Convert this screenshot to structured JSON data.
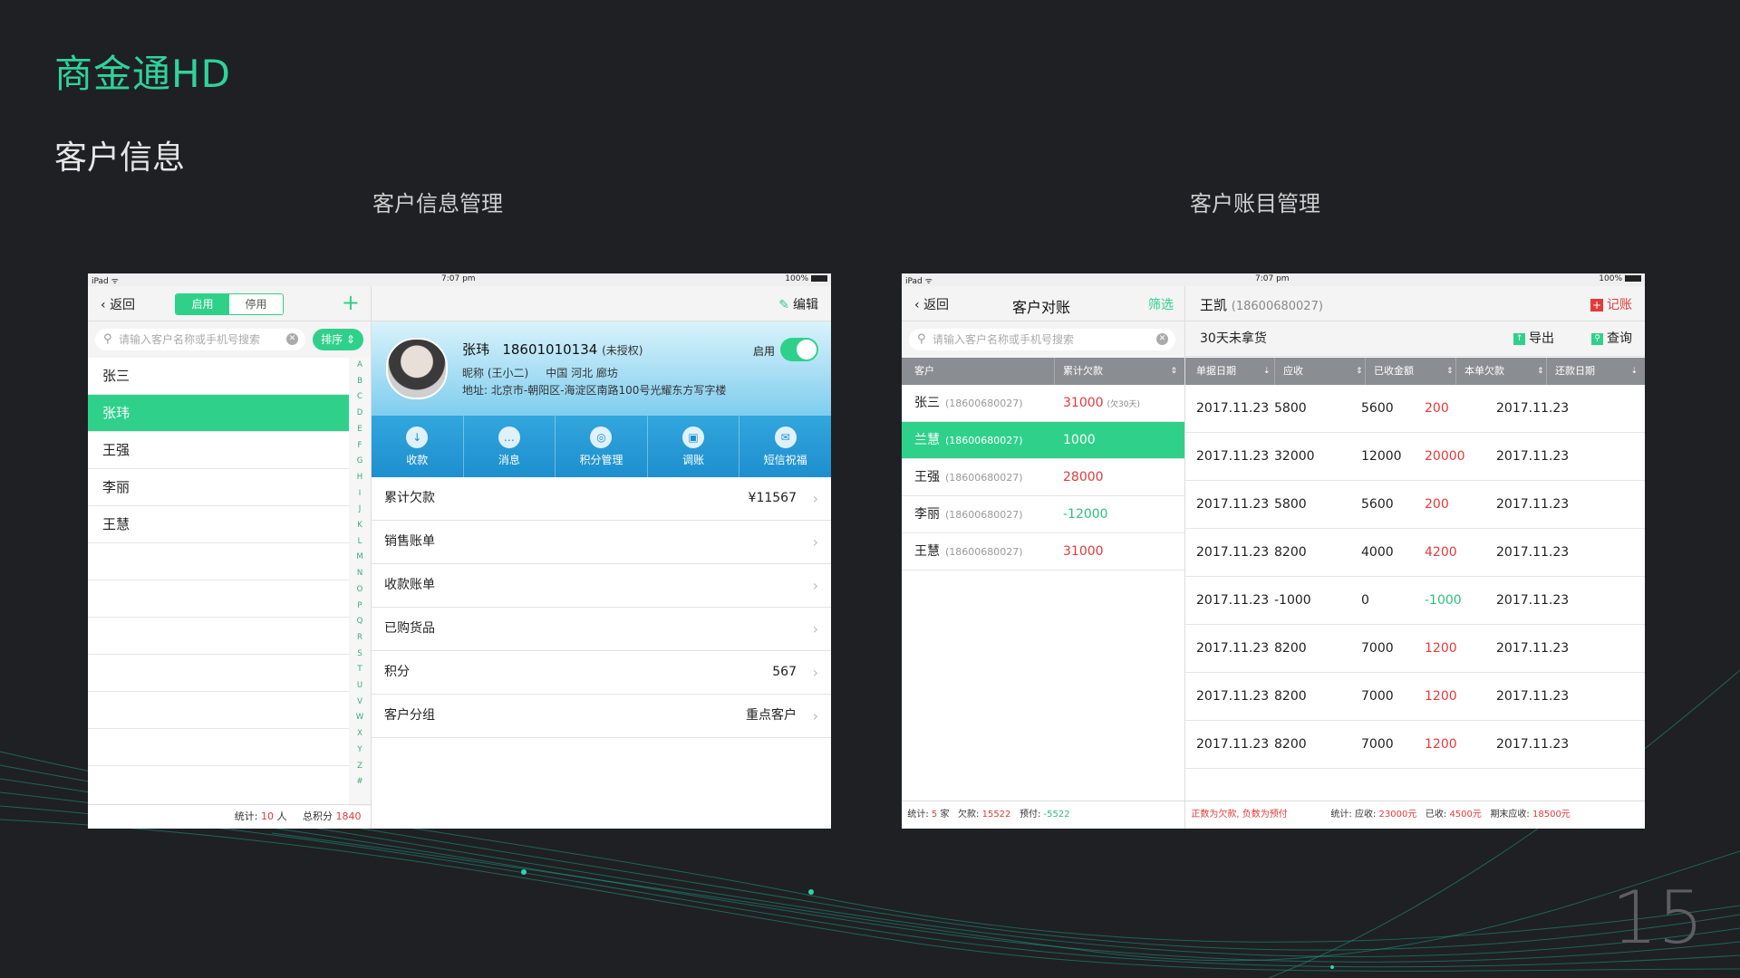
{
  "slide": {
    "title": "商金通HD",
    "subtitle": "客户信息",
    "left_section": "客户信息管理",
    "right_section": "客户账目管理",
    "page_number": "15"
  },
  "status": {
    "device": "iPad ᯤ",
    "time": "7:07 pm",
    "battery": "100%"
  },
  "info_screen": {
    "back": "返回",
    "seg_on": "启用",
    "seg_off": "停用",
    "add": "+",
    "search_placeholder": "请输入客户名称或手机号搜索",
    "sort": "排序 ⇕",
    "customers": [
      "张三",
      "张玮",
      "王强",
      "李丽",
      "王慧"
    ],
    "alphabet": [
      "A",
      "B",
      "C",
      "D",
      "E",
      "F",
      "G",
      "H",
      "I",
      "J",
      "K",
      "L",
      "M",
      "N",
      "O",
      "P",
      "Q",
      "R",
      "S",
      "T",
      "U",
      "V",
      "W",
      "X",
      "Y",
      "Z",
      "#"
    ],
    "footer_count_label": "统计:",
    "footer_count": "10",
    "footer_count_unit": "人",
    "footer_points_label": "总积分",
    "footer_points": "1840",
    "edit": "编辑",
    "profile": {
      "name": "张玮",
      "phone": "18601010134",
      "auth": "(未授权)",
      "nick": "昵称 (王小二)",
      "region": "中国 河北 廊坊",
      "address": "地址: 北京市-朝阳区-海淀区南路100号光耀东方写字楼",
      "enable": "启用"
    },
    "actions": [
      "收款",
      "消息",
      "积分管理",
      "调账",
      "短信祝福"
    ],
    "menu": [
      {
        "label": "累计欠款",
        "value": "¥11567"
      },
      {
        "label": "销售账单",
        "value": ""
      },
      {
        "label": "收款账单",
        "value": ""
      },
      {
        "label": "已购货品",
        "value": ""
      },
      {
        "label": "积分",
        "value": "567"
      },
      {
        "label": "客户分组",
        "value": "重点客户"
      }
    ]
  },
  "account_screen": {
    "back": "返回",
    "title": "客户对账",
    "filter": "筛选",
    "search_placeholder": "请输入客户名称或手机号搜索",
    "left_headers": [
      "客户",
      "累计欠款"
    ],
    "debtors": [
      {
        "name": "张三",
        "phone": "(18600680027)",
        "amount": "31000",
        "note": "(欠30天)"
      },
      {
        "name": "兰慧",
        "phone": "(18600680027)",
        "amount": "1000",
        "note": ""
      },
      {
        "name": "王强",
        "phone": "(18600680027)",
        "amount": "28000",
        "note": ""
      },
      {
        "name": "李丽",
        "phone": "(18600680027)",
        "amount": "-12000",
        "note": ""
      },
      {
        "name": "王慧",
        "phone": "(18600680027)",
        "amount": "31000",
        "note": ""
      }
    ],
    "left_footer": {
      "count_label": "统计:",
      "count": "5",
      "count_unit": "家",
      "debt_label": "欠款:",
      "debt": "15522",
      "prepay_label": "预付:",
      "prepay": "-5522"
    },
    "customer": "王凯",
    "customer_phone": "(18600680027)",
    "record": "记账",
    "sub_label": "30天未拿货",
    "export": "导出",
    "query": "查询",
    "table_headers": [
      "单据日期",
      "应收",
      "已收金额",
      "本单欠款",
      "还款日期"
    ],
    "bills": [
      [
        "2017.11.23",
        "5800",
        "5600",
        "200",
        "2017.11.23"
      ],
      [
        "2017.11.23",
        "32000",
        "12000",
        "20000",
        "2017.11.23"
      ],
      [
        "2017.11.23",
        "5800",
        "5600",
        "200",
        "2017.11.23"
      ],
      [
        "2017.11.23",
        "8200",
        "4000",
        "4200",
        "2017.11.23"
      ],
      [
        "2017.11.23",
        "-1000",
        "0",
        "-1000",
        "2017.11.23"
      ],
      [
        "2017.11.23",
        "8200",
        "7000",
        "1200",
        "2017.11.23"
      ],
      [
        "2017.11.23",
        "8200",
        "7000",
        "1200",
        "2017.11.23"
      ],
      [
        "2017.11.23",
        "8200",
        "7000",
        "1200",
        "2017.11.23"
      ]
    ],
    "right_footer": {
      "note": "正数为欠款, 负数为预付",
      "stat_label": "统计: 应收:",
      "receivable": "23000元",
      "received_label": "已收:",
      "received": "4500元",
      "end_label": "期末应收:",
      "end": "18500元"
    }
  },
  "colors": {
    "accent": "#2fd18a",
    "red": "#e23a3a",
    "blue": "#1d8fcf",
    "background": "#1f2024"
  }
}
